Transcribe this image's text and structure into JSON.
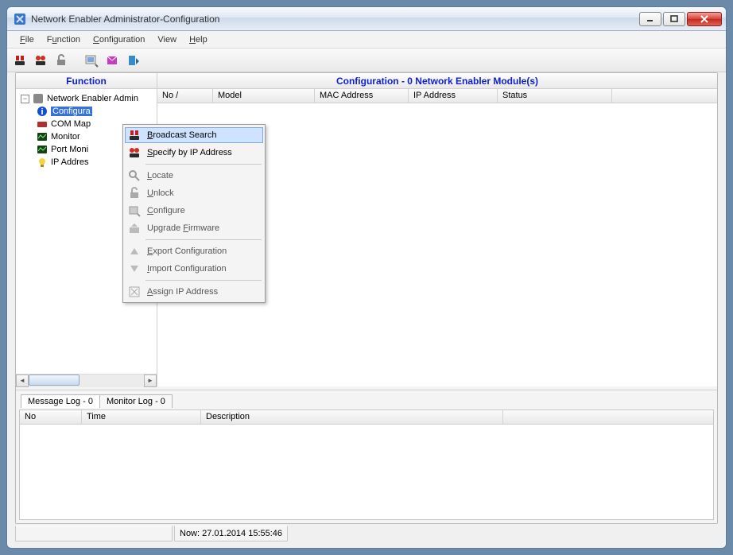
{
  "window": {
    "title": "Network Enabler Administrator-Configuration"
  },
  "menubar": {
    "file": "File",
    "function": "Function",
    "configuration": "Configuration",
    "view": "View",
    "help": "Help"
  },
  "headers": {
    "left": "Function",
    "right": "Configuration - 0 Network Enabler Module(s)"
  },
  "tree": {
    "root": "Network Enabler Admin",
    "items": [
      "Configura",
      "COM Map",
      "Monitor",
      "Port Moni",
      "IP Addres"
    ]
  },
  "grid": {
    "cols": [
      "No   /",
      "Model",
      "MAC Address",
      "IP Address",
      "Status"
    ]
  },
  "log": {
    "tabs": [
      "Message Log - 0",
      "Monitor Log - 0"
    ],
    "cols": [
      "No",
      "Time",
      "Description"
    ]
  },
  "status": {
    "now": "Now: 27.01.2014 15:55:46"
  },
  "ctx": {
    "items": [
      {
        "label": "Broadcast Search",
        "enabled": true,
        "hover": true,
        "u": 0,
        "icon": "broadcast"
      },
      {
        "label": "Specify by IP Address",
        "enabled": true,
        "u": 0,
        "icon": "specify"
      },
      {
        "sep": true
      },
      {
        "label": "Locate",
        "enabled": false,
        "u": 0,
        "icon": "locate"
      },
      {
        "label": "Unlock",
        "enabled": false,
        "u": 0,
        "icon": "unlock"
      },
      {
        "label": "Configure",
        "enabled": false,
        "u": 0,
        "icon": "configure"
      },
      {
        "label": "Upgrade Firmware",
        "enabled": false,
        "u": 1,
        "icon": "upgrade"
      },
      {
        "sep": true
      },
      {
        "label": "Export Configuration",
        "enabled": false,
        "u": 0,
        "icon": "export"
      },
      {
        "label": "Import Configuration",
        "enabled": false,
        "u": 0,
        "icon": "import"
      },
      {
        "sep": true
      },
      {
        "label": "Assign IP Address",
        "enabled": false,
        "u": 0,
        "icon": "assign"
      }
    ]
  }
}
